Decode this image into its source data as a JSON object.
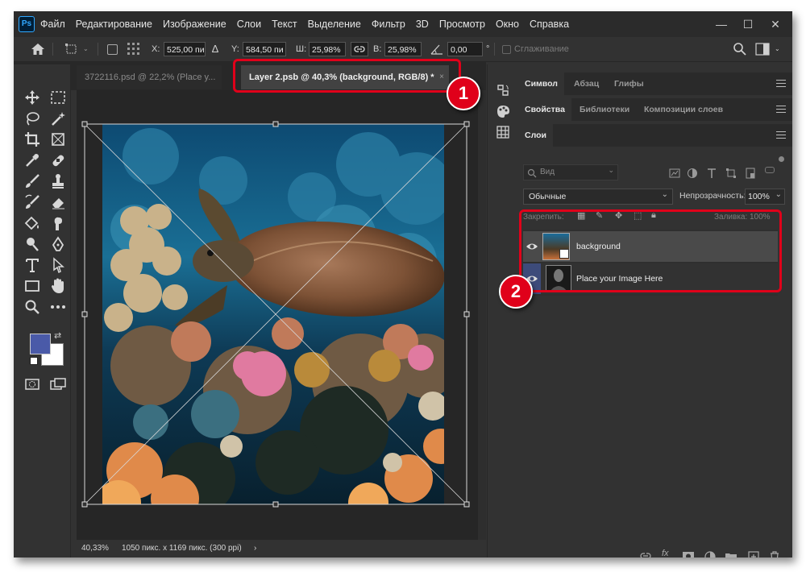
{
  "app": {
    "logo": "Ps"
  },
  "menu": [
    "Файл",
    "Редактирование",
    "Изображение",
    "Слои",
    "Текст",
    "Выделение",
    "Фильтр",
    "3D",
    "Просмотр",
    "Окно",
    "Справка"
  ],
  "window_controls": {
    "minimize": "—",
    "maximize": "☐",
    "close": "✕"
  },
  "options": {
    "x_label": "X:",
    "x_value": "525,00 пи",
    "y_label": "Y:",
    "y_value": "584,50 пи",
    "w_label": "Ш:",
    "w_value": "25,98%",
    "h_label": "В:",
    "h_value": "25,98%",
    "angle_value": "0,00",
    "angle_unit": "°",
    "smoothing_label": "Сглаживание"
  },
  "tabs": [
    {
      "label": "3722116.psd @ 22,2% (Place y...",
      "active": false
    },
    {
      "label": "Layer 2.psb @ 40,3% (background, RGB/8) *",
      "active": true,
      "close": "×"
    }
  ],
  "status": {
    "zoom": "40,33%",
    "info": "1050 пикс. x 1169 пикс. (300 ppi)",
    "arrow": "›"
  },
  "panels": {
    "top_tabs": [
      "Символ",
      "Абзац",
      "Глифы"
    ],
    "mid_tabs": [
      "Свойства",
      "Библиотеки",
      "Композиции слоев"
    ],
    "layers_tab": "Слои",
    "search_placeholder": "Вид",
    "blend_mode": "Обычные",
    "opacity_label": "Непрозрачность:",
    "opacity_value": "100%",
    "lock_label": "Закрепить:",
    "fill_label": "Заливка:",
    "fill_value": "100%"
  },
  "layers": [
    {
      "name": "background",
      "selected": true,
      "visible": true
    },
    {
      "name": "Place your Image Here",
      "selected": false,
      "visible": true
    }
  ],
  "annotations": {
    "badge1": "1",
    "badge2": "2"
  },
  "colors": {
    "accent_red": "#e0001a",
    "foreground": "#4a5aa8",
    "background": "#ffffff",
    "selection_blue": "#3d4b7a"
  },
  "panel_collapse": {
    "left": "«",
    "right": "»"
  }
}
